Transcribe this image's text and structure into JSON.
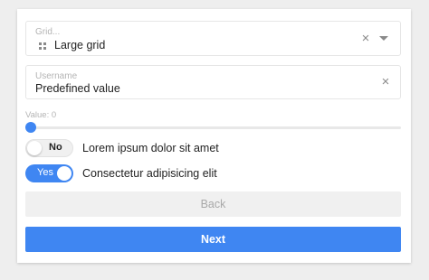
{
  "grid_select": {
    "label": "Grid...",
    "value": "Large grid",
    "icon": "grid-icon",
    "clear_glyph": "×"
  },
  "username": {
    "label": "Username",
    "value": "Predefined value",
    "clear_glyph": "×"
  },
  "slider": {
    "label": "Value: 0",
    "value": 0,
    "accent": "#3f86f2"
  },
  "toggles": [
    {
      "state_label": "No",
      "text": "Lorem ipsum dolor sit amet",
      "checked": false
    },
    {
      "state_label": "Yes",
      "text": "Consectetur adipisicing elit",
      "checked": true
    }
  ],
  "buttons": {
    "back": "Back",
    "next": "Next"
  },
  "colors": {
    "primary": "#3f86f2",
    "disabled_bg": "#f0f0f0",
    "disabled_text": "#a8a8a8"
  }
}
